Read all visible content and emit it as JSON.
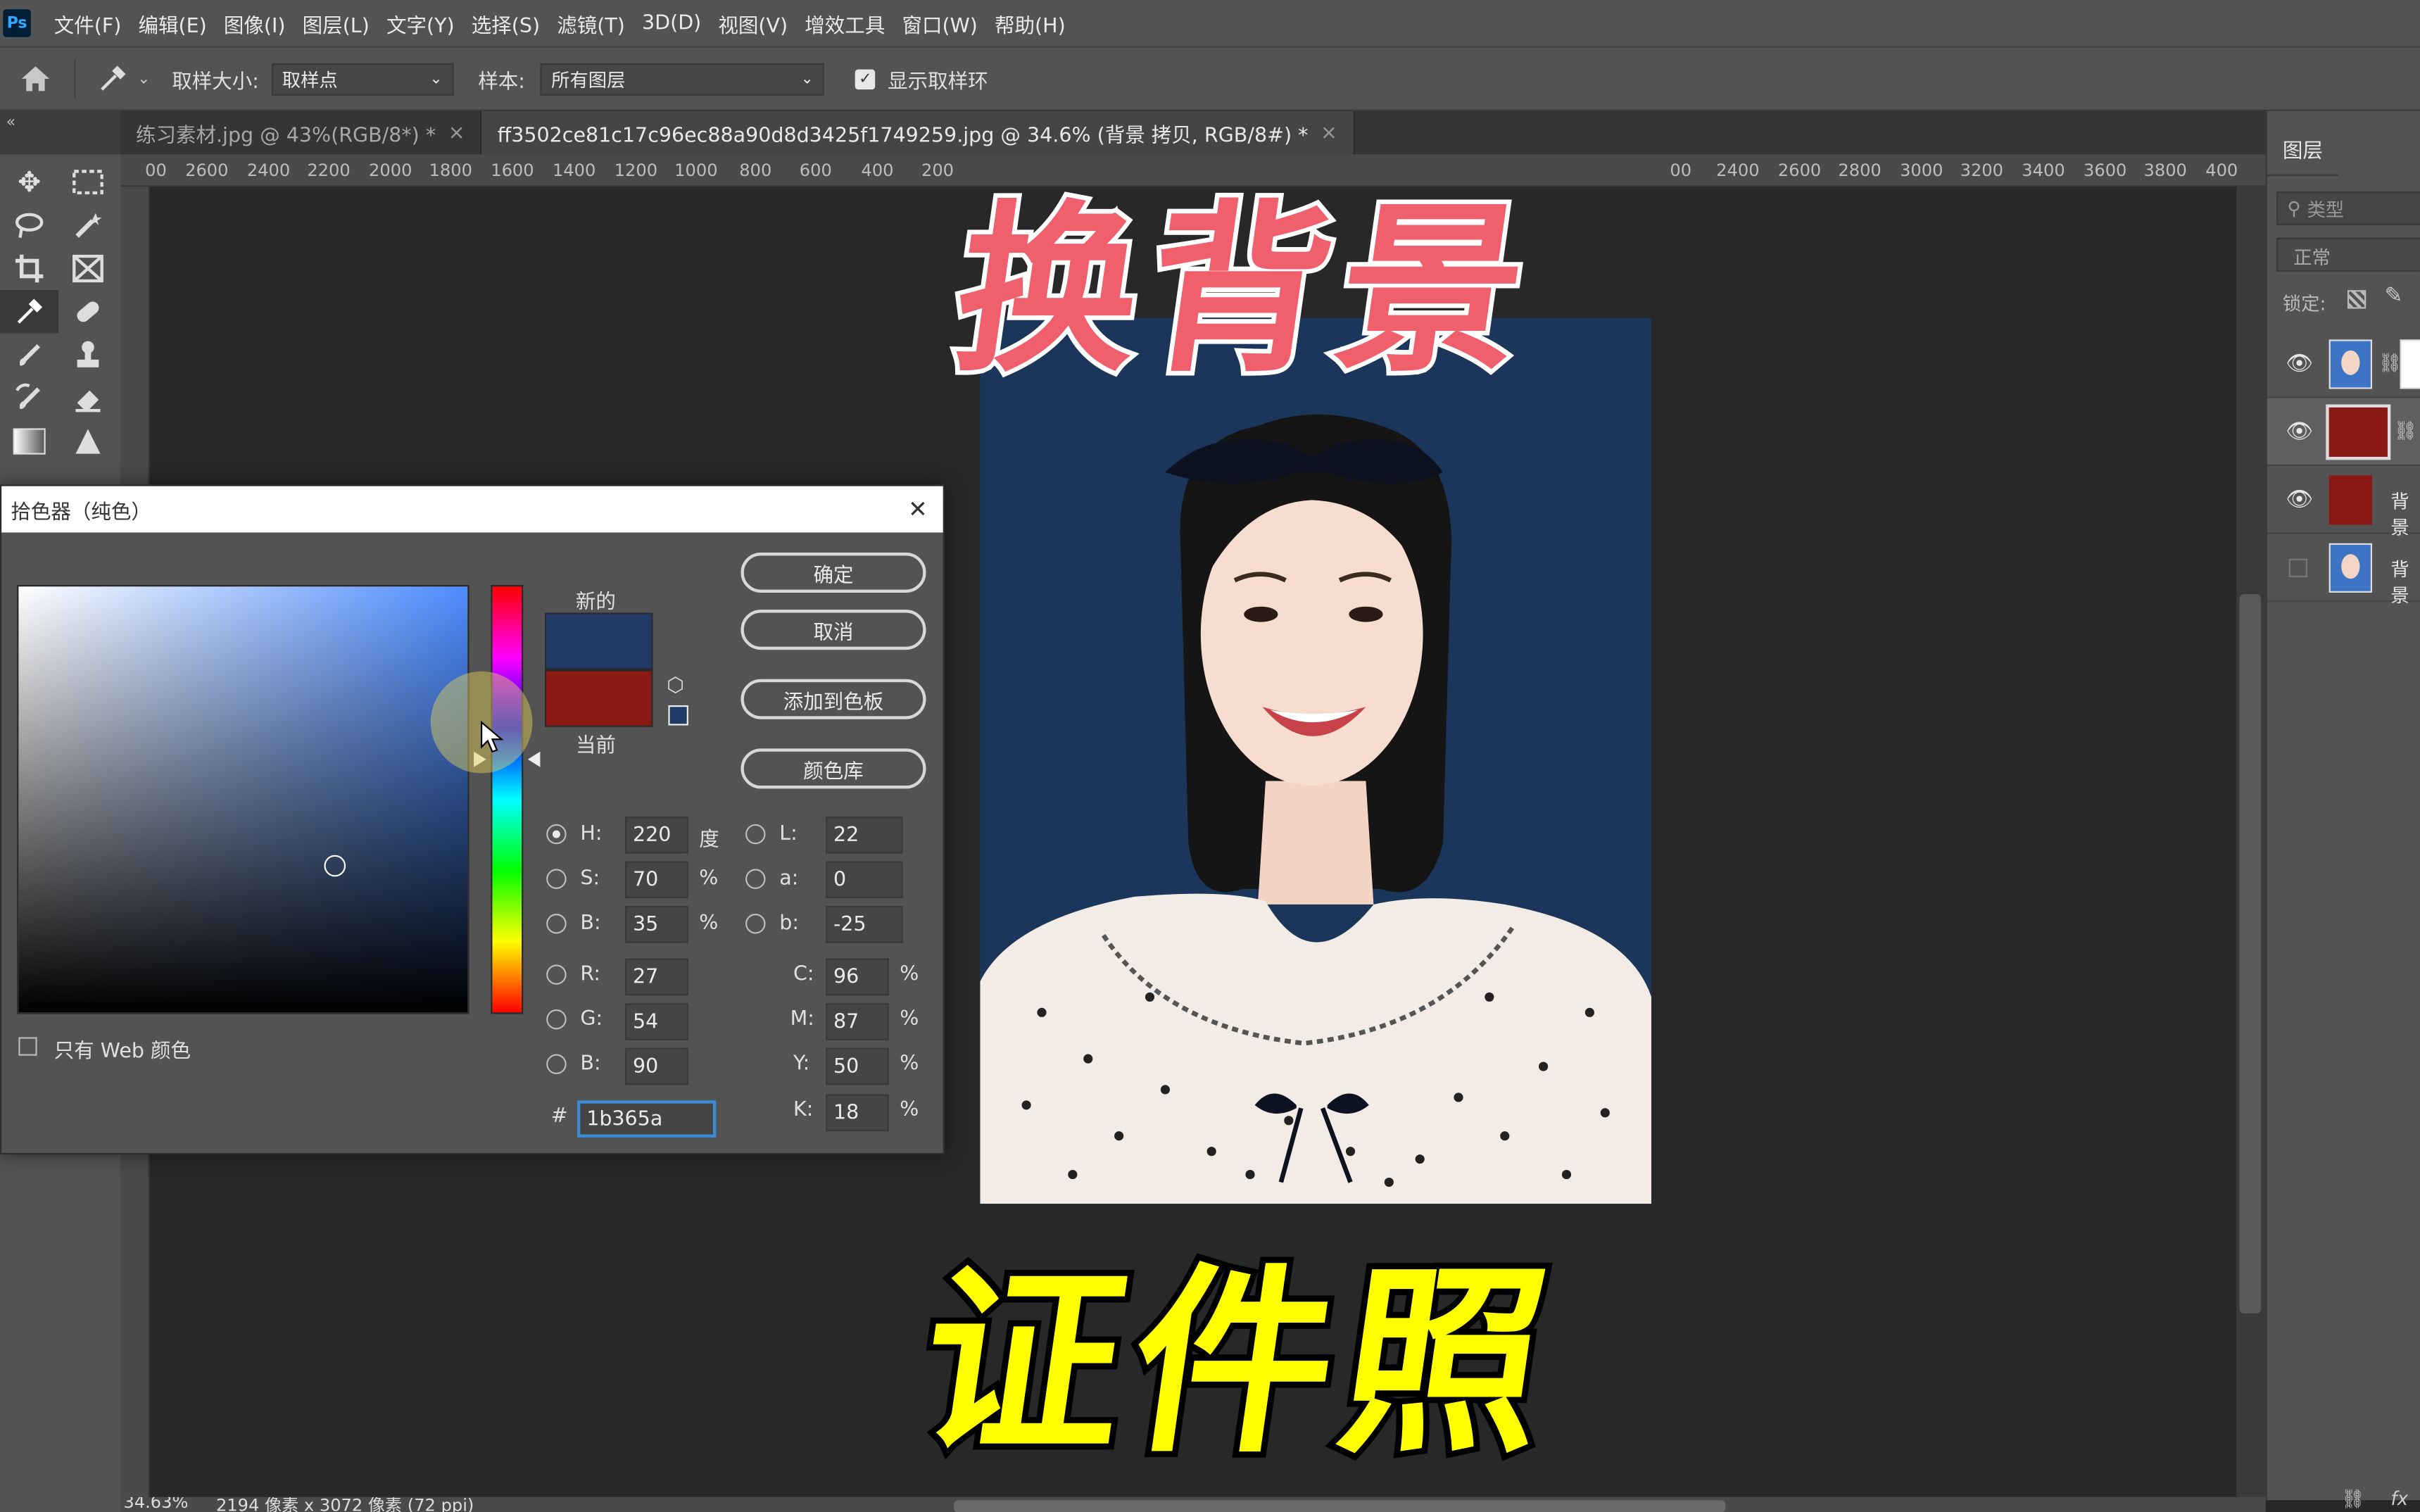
{
  "app": {
    "logo": "Ps"
  },
  "menu": [
    "文件(F)",
    "编辑(E)",
    "图像(I)",
    "图层(L)",
    "文字(Y)",
    "选择(S)",
    "滤镜(T)",
    "3D(D)",
    "视图(V)",
    "增效工具",
    "窗口(W)",
    "帮助(H)"
  ],
  "options": {
    "sample_size_label": "取样大小:",
    "sample_size_value": "取样点",
    "sample_label": "样本:",
    "sample_value": "所有图层",
    "show_ring_label": "显示取样环"
  },
  "tabs": [
    {
      "label": "练习素材.jpg @ 43%(RGB/8*) *",
      "close": "×"
    },
    {
      "label": "ff3502ce81c17c96ec88a90d8d3425f1749259.jpg @ 34.6% (背景 拷贝, RGB/8#) *",
      "close": "×"
    }
  ],
  "ruler": {
    "left_ticks": [
      "00",
      "2600",
      "2400",
      "2200",
      "2000",
      "1800",
      "1600",
      "1400",
      "1200",
      "1000",
      "800",
      "600",
      "400",
      "200"
    ],
    "right_ticks": [
      "00",
      "2400",
      "2600",
      "2800",
      "3000",
      "3200",
      "3400",
      "3600",
      "3800",
      "400"
    ]
  },
  "layers_panel": {
    "tab": "图层",
    "search_placeholder": "类型",
    "blend_mode": "正常",
    "lock_label": "锁定:",
    "layers": [
      {
        "name": "",
        "visible": true,
        "thumb": "portrait"
      },
      {
        "name": "",
        "visible": true,
        "thumb": "red-fill"
      },
      {
        "name": "背景",
        "visible": true,
        "thumb": "red"
      },
      {
        "name": "背景",
        "visible": false,
        "thumb": "portrait"
      }
    ],
    "fx": "fx"
  },
  "dialog": {
    "title": "拾色器（纯色）",
    "close": "✕",
    "new_label": "新的",
    "current_label": "当前",
    "new_color": "#213a66",
    "current_color": "#8b1a14",
    "ok": "确定",
    "cancel": "取消",
    "add_swatch": "添加到色板",
    "libraries": "颜色库",
    "web_only": "只有 Web 颜色",
    "hsb": {
      "h_label": "H:",
      "h": "220",
      "h_unit": "度",
      "s_label": "S:",
      "s": "70",
      "s_unit": "%",
      "b_label": "B:",
      "b": "35",
      "b_unit": "%"
    },
    "lab": {
      "l_label": "L:",
      "l": "22",
      "a_label": "a:",
      "a": "0",
      "b_label": "b:",
      "b": "-25"
    },
    "rgb": {
      "r_label": "R:",
      "r": "27",
      "g_label": "G:",
      "g": "54",
      "b_label": "B:",
      "b": "90"
    },
    "cmyk": {
      "c_label": "C:",
      "c": "96",
      "m_label": "M:",
      "m": "87",
      "y_label": "Y:",
      "y": "50",
      "k_label": "K:",
      "k": "18",
      "unit": "%"
    },
    "hex_label": "#",
    "hex": "1b365a"
  },
  "captions": {
    "top": "换背景",
    "bottom": "证件照"
  },
  "status": {
    "zoom": "34.63%",
    "info": "2194 像素 x 3072 像素 (72 ppi)"
  },
  "colors": {
    "photo_bg": "#1b365a",
    "caption_top": "#f0606c",
    "caption_bottom": "#ffff00"
  }
}
